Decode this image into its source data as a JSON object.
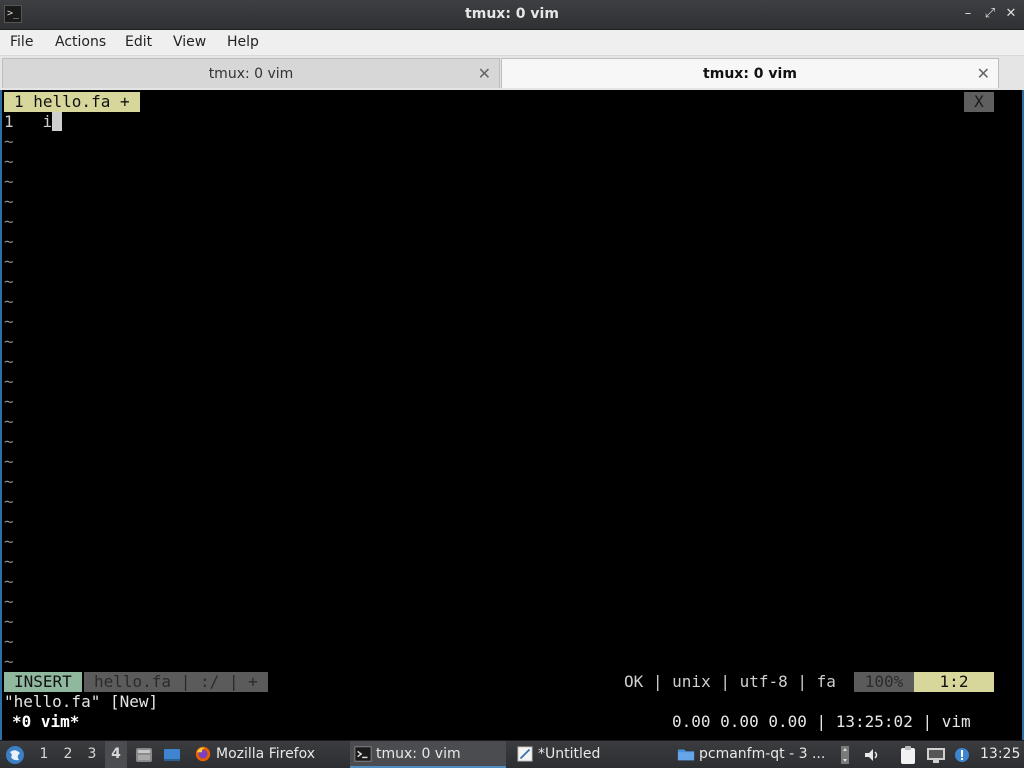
{
  "window": {
    "title": "tmux: 0 vim",
    "minimize_glyph": "–",
    "maximize_glyph": "⤢",
    "close_glyph": "✕"
  },
  "menu": [
    "File",
    "Actions",
    "Edit",
    "View",
    "Help"
  ],
  "tabs": [
    {
      "label": "tmux: 0 vim",
      "active": false
    },
    {
      "label": "tmux: 0 vim",
      "active": true
    }
  ],
  "vim": {
    "buffer_tab": "1 hello.fa +",
    "close_label": "X",
    "line_number": "1",
    "line_text": "i",
    "tilde": "~",
    "status": {
      "mode": "INSERT",
      "file_segment": "hello.fa | :/ | +",
      "right_segment": "OK | unix | utf-8 | fa",
      "percent": "100%",
      "position": "1:2"
    },
    "message": "\"hello.fa\" [New]"
  },
  "tmux": {
    "window_list": "*0 vim*",
    "status_right": "0.00 0.00 0.00 | 13:25:02 | vim"
  },
  "taskbar": {
    "workspaces": [
      "1",
      "2",
      "3",
      "4"
    ],
    "active_workspace": "4",
    "tasks": [
      {
        "label": "Mozilla Firefox",
        "icon": "firefox-icon",
        "active": false
      },
      {
        "label": "tmux: 0 vim",
        "icon": "terminal-icon",
        "active": true
      },
      {
        "label": "*Untitled",
        "icon": "text-editor-icon",
        "active": false
      },
      {
        "label": "pcmanfm-qt - 3 ...",
        "icon": "folder-icon",
        "active": false
      }
    ],
    "clock": "13:25"
  },
  "colors": {
    "accent": "#2d6fa5",
    "vim_tab": "#d7d79b",
    "insert_mode": "#8fb89f"
  }
}
